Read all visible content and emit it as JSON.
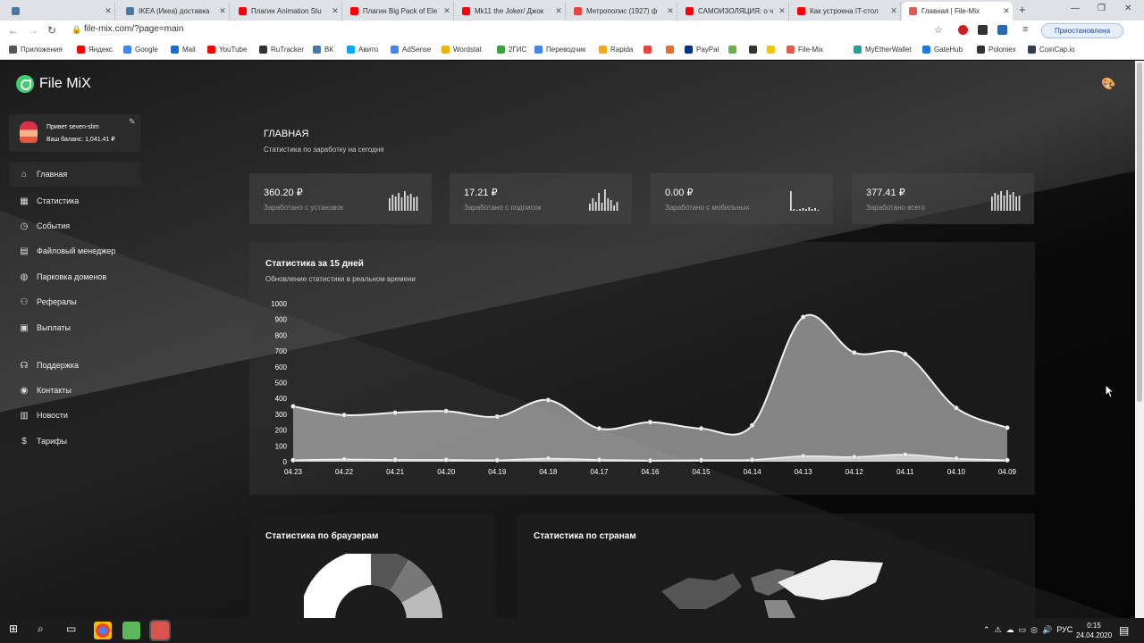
{
  "browser": {
    "tabs": [
      {
        "title": "",
        "fav": "#4a76a8"
      },
      {
        "title": "IKEA (Икеа) доставка",
        "fav": "#4a76a8"
      },
      {
        "title": "Плагин Animation Stu",
        "fav": "#ff0000"
      },
      {
        "title": "Плагин Big Pack of Ele",
        "fav": "#ff0000"
      },
      {
        "title": "Mk11 the Joker/ Джок",
        "fav": "#ff0000"
      },
      {
        "title": "Метрополис (1927) ф",
        "fav": "#e8453c"
      },
      {
        "title": "САМОИЗОЛЯЦИЯ: о ч",
        "fav": "#ff0000"
      },
      {
        "title": "Как устроена IT-стол",
        "fav": "#ff0000"
      },
      {
        "title": "Главная | File-Mix",
        "fav": "#e05a4e"
      }
    ],
    "url": "file-mix.com/?page=main",
    "paused_label": "Приостановлена",
    "bookmarks": [
      "Приложения",
      "Яндекс",
      "Google",
      "Mail",
      "YouTube",
      "RuTracker",
      "ВК",
      "Авито",
      "AdSense",
      "Wordstat",
      "2ГИС",
      "Переводчик",
      "Rapida",
      "",
      "",
      "PayPal",
      "",
      "",
      "",
      "File-Mix",
      "MyEtherWallet",
      "GateHub",
      "Poloniex",
      "CoinCap.io"
    ]
  },
  "site": {
    "logo": "File MiX",
    "user": {
      "greeting": "Привет seven-slim",
      "balance": "Ваш баланс: 1,041.41 ₽"
    },
    "menu": [
      {
        "label": "Главная",
        "icon": "home-icon"
      },
      {
        "label": "Статистика",
        "icon": "calendar-icon"
      },
      {
        "label": "События",
        "icon": "history-icon"
      },
      {
        "label": "Файловый менеджер",
        "icon": "folder-icon"
      },
      {
        "label": "Парковка доменов",
        "icon": "globe-icon"
      },
      {
        "label": "Рефералы",
        "icon": "users-icon"
      },
      {
        "label": "Выплаты",
        "icon": "wallet-icon"
      },
      {
        "label": "Поддержка",
        "icon": "headset-icon"
      },
      {
        "label": "Контакты",
        "icon": "contact-icon"
      },
      {
        "label": "Новости",
        "icon": "news-icon"
      },
      {
        "label": "Тарифы",
        "icon": "dollar-icon"
      }
    ],
    "page_title": "ГЛАВНАЯ",
    "page_subtitle": "Статистика по заработку на сегодня",
    "cards": [
      {
        "value": "360.20 ₽",
        "label": "Заработано с установок",
        "bars": [
          14,
          18,
          16,
          20,
          15,
          22,
          17,
          19,
          15,
          16
        ]
      },
      {
        "value": "17.21 ₽",
        "label": "Заработано с подписок",
        "bars": [
          8,
          14,
          10,
          20,
          9,
          24,
          14,
          12,
          6,
          10
        ]
      },
      {
        "value": "0.00 ₽",
        "label": "Заработано с мобильных",
        "bars": [
          22,
          2,
          1,
          2,
          3,
          2,
          4,
          2,
          3,
          1
        ]
      },
      {
        "value": "377.41 ₽",
        "label": "Заработано всего",
        "bars": [
          16,
          20,
          18,
          22,
          17,
          23,
          18,
          21,
          16,
          17
        ]
      }
    ],
    "chart_panel": {
      "title": "Статистика за 15 дней",
      "subtitle": "Обновление статистики в реальном времени"
    },
    "browsers_title": "Статистика по браузерам",
    "countries_title": "Статистика по странам"
  },
  "chart_data": {
    "type": "area",
    "categories": [
      "04.23",
      "04.22",
      "04.21",
      "04.20",
      "04.19",
      "04.18",
      "04.17",
      "04.16",
      "04.15",
      "04.14",
      "04.13",
      "04.12",
      "04.11",
      "04.10",
      "04.09"
    ],
    "yticks": [
      0,
      100,
      200,
      300,
      400,
      500,
      600,
      700,
      800,
      900,
      1000
    ],
    "ylim": [
      0,
      1000
    ],
    "series": [
      {
        "values": [
          350,
          295,
          310,
          320,
          285,
          390,
          210,
          250,
          210,
          230,
          915,
          690,
          680,
          340,
          215
        ]
      },
      {
        "values": [
          10,
          15,
          12,
          12,
          10,
          20,
          12,
          8,
          10,
          12,
          35,
          30,
          45,
          20,
          10
        ]
      }
    ]
  },
  "taskbar": {
    "lang": "РУС",
    "time": "0:15",
    "date": "24.04.2020"
  }
}
